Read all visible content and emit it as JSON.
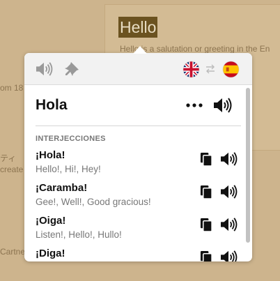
{
  "background": {
    "selected_word": "Hello",
    "definition_line": "Hello is a salutation or greeting in the En",
    "fragment_1": "om 18",
    "fragment_2": "ティ",
    "fragment_3": "create",
    "fragment_4": "Cartne"
  },
  "toolbar": {
    "speaker_icon": "speaker-icon",
    "pin_icon": "pin-icon",
    "source_flag": "uk-flag-icon",
    "swap_icon": "swap-icon",
    "target_flag": "spain-flag-icon"
  },
  "translation": {
    "word": "Hola",
    "more_icon": "more-dots-icon",
    "speaker_icon": "speaker-icon"
  },
  "section": {
    "title": "INTERJECCIONES"
  },
  "items": [
    {
      "word": "¡Hola!",
      "translations": "Hello!, Hi!, Hey!"
    },
    {
      "word": "¡Caramba!",
      "translations": "Gee!, Well!, Good gracious!"
    },
    {
      "word": "¡Oiga!",
      "translations": "Listen!, Hello!, Hullo!"
    },
    {
      "word": "¡Diga!",
      "translations": ""
    }
  ],
  "colors": {
    "page_background": "#cdb48d",
    "highlight": "#6b5220",
    "popup_background": "#ffffff",
    "toolbar_background": "#f2f2f2"
  }
}
